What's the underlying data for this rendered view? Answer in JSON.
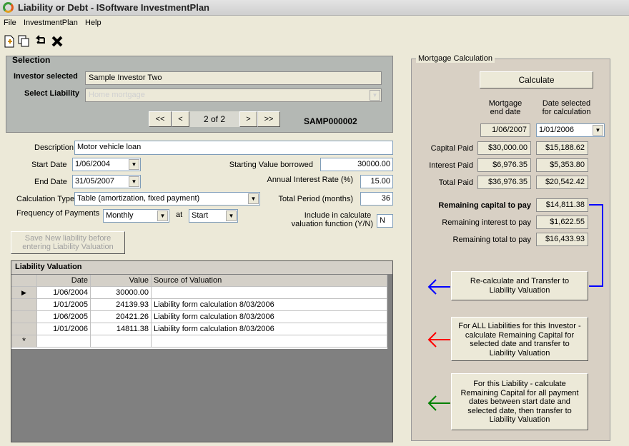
{
  "window": {
    "title": "Liability or Debt - ISoftware InvestmentPlan"
  },
  "menu": {
    "file": "File",
    "investment_plan": "InvestmentPlan",
    "help": "Help"
  },
  "selection": {
    "group_title": "Selection",
    "investor_label": "Investor selected",
    "investor_value": "Sample Investor Two",
    "liability_label": "Select Liability",
    "liability_value": "Home mortgage",
    "nav": {
      "first": "<<",
      "prev": "<",
      "position": "2 of 2",
      "next": ">",
      "last": ">>"
    },
    "code": "SAMP000002"
  },
  "form": {
    "description_label": "Description",
    "description_value": "Motor vehicle loan",
    "start_date_label": "Start Date",
    "start_date_value": "1/06/2004",
    "end_date_label": "End Date",
    "end_date_value": "31/05/2007",
    "calc_type_label": "Calculation Type",
    "calc_type_value": "Table (amortization, fixed payment)",
    "frequency_label": "Frequency of Payments",
    "frequency_value": "Monthly",
    "at_label": "at",
    "at_value": "Start",
    "starting_value_label": "Starting Value borrowed",
    "starting_value": "30000.00",
    "interest_rate_label": "Annual Interest Rate (%)",
    "interest_rate_value": "15.00",
    "total_period_label": "Total Period (months)",
    "total_period_value": "36",
    "include_label_1": "Include in calculate",
    "include_label_2": "valuation function (Y/N)",
    "include_value": "N",
    "save_button_1": "Save New liability before",
    "save_button_2": "entering Liability Valuation"
  },
  "valuation": {
    "title": "Liability Valuation",
    "headers": {
      "date": "Date",
      "value": "Value",
      "source": "Source of Valuation"
    },
    "rows": [
      {
        "date": "1/06/2004",
        "value": "30000.00",
        "source": ""
      },
      {
        "date": "1/01/2005",
        "value": "24139.93",
        "source": "Liability form calculation 8/03/2006"
      },
      {
        "date": "1/06/2005",
        "value": "20421.26",
        "source": "Liability form calculation 8/03/2006"
      },
      {
        "date": "1/01/2006",
        "value": "14811.38",
        "source": "Liability form calculation 8/03/2006"
      }
    ],
    "current_row_marker": "▶",
    "new_row_marker": "*"
  },
  "mortgage": {
    "group_title": "Mortgage Calculation",
    "calculate_button": "Calculate",
    "col1_header_1": "Mortgage",
    "col1_header_2": "end date",
    "col2_header_1": "Date selected",
    "col2_header_2": "for calculation",
    "end_date": "1/06/2007",
    "selected_date": "1/01/2006",
    "capital_paid_label": "Capital Paid",
    "capital_paid_1": "$30,000.00",
    "capital_paid_2": "$15,188.62",
    "interest_paid_label": "Interest Paid",
    "interest_paid_1": "$6,976.35",
    "interest_paid_2": "$5,353.80",
    "total_paid_label": "Total Paid",
    "total_paid_1": "$36,976.35",
    "total_paid_2": "$20,542.42",
    "remaining_capital_label": "Remaining capital to pay",
    "remaining_capital": "$14,811.38",
    "remaining_interest_label": "Remaining interest to pay",
    "remaining_interest": "$1,622.55",
    "remaining_total_label": "Remaining total to pay",
    "remaining_total": "$16,433.93",
    "recalc_button_1": "Re-calculate and Transfer to",
    "recalc_button_2": "Liability Valuation",
    "all_button_1": "For ALL Liabilities for this Investor -",
    "all_button_2": "calculate Remaining Capital for",
    "all_button_3": "selected date and transfer to",
    "all_button_4": "Liability Valuation",
    "this_button_1": "For this Liability - calculate",
    "this_button_2": "Remaining Capital for all payment",
    "this_button_3": "dates between start date and",
    "this_button_4": "selected date, then transfer to",
    "this_button_5": "Liability Valuation"
  },
  "colors": {
    "blue_arrow": "#0000ff",
    "red_arrow": "#ff0000",
    "green_arrow": "#008000"
  }
}
